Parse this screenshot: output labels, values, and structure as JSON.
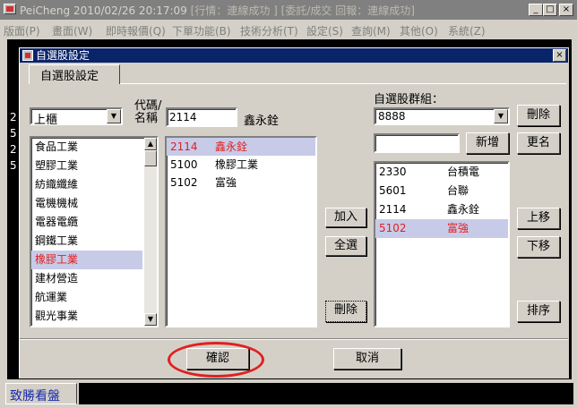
{
  "main": {
    "title_app": "PeiCheng",
    "title_datetime": "2010/02/26 20:17:09",
    "title_status": "[行情：連線成功 ] [委託/成交 回報：連線成功]",
    "menu": [
      "版面(P)",
      "畫面(W)",
      "即時報價(Q)",
      "下單功能(B)",
      "技術分析(T)",
      "設定(S)",
      "查詢(M)",
      "其他(O)",
      "系統(Z)"
    ],
    "win_minimize": "_",
    "win_maximize": "□",
    "win_close": "×",
    "left_digits": [
      "2",
      "5",
      "2",
      "5"
    ],
    "bottom_tab": "致勝看盤"
  },
  "dialog": {
    "title": "自選股設定",
    "close": "×",
    "tab_label": "自選股設定",
    "market_select": "上櫃",
    "code_label_1": "代碼/",
    "code_label_2": "名稱",
    "code_input": "2114",
    "code_name": "鑫永銓",
    "group_label": "自選股群組：",
    "group_select": "8888",
    "new_group_input": "",
    "buttons": {
      "delete_group": "刪除",
      "new_group": "新增",
      "rename": "更名",
      "add": "加入",
      "select_all": "全選",
      "delete_item": "刪除",
      "move_up": "上移",
      "move_down": "下移",
      "sort": "排序",
      "confirm": "確認",
      "cancel": "取消"
    },
    "industry_list": [
      "食品工業",
      "塑膠工業",
      "紡織纖維",
      "電機機械",
      "電器電纜",
      "鋼鐵工業",
      "橡膠工業",
      "建材營造",
      "航運業",
      "觀光事業"
    ],
    "industry_selected": 6,
    "stock_list": [
      {
        "code": "2114",
        "name": "鑫永銓"
      },
      {
        "code": "5100",
        "name": "橡膠工業"
      },
      {
        "code": "5102",
        "name": "富強"
      }
    ],
    "stock_selected": 0,
    "group_stocks": [
      {
        "code": "2330",
        "name": "台積電"
      },
      {
        "code": "5601",
        "name": "台聯"
      },
      {
        "code": "2114",
        "name": "鑫永銓"
      },
      {
        "code": "5102",
        "name": "富強"
      }
    ],
    "group_selected": 3
  },
  "colors": {
    "selected_text": "#e02020",
    "selected_bg": "#c7cbe8",
    "dialog_title": "#0a246a",
    "highlight_oval": "#e02020"
  }
}
